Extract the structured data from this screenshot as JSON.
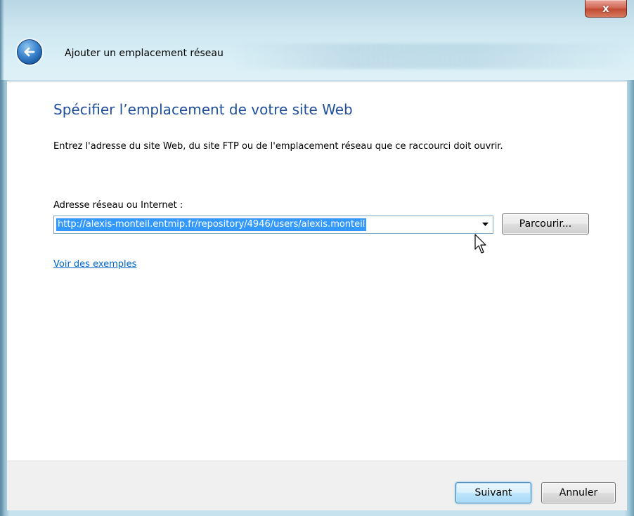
{
  "window": {
    "close_label": "x",
    "nav_title": "Ajouter un emplacement réseau"
  },
  "main": {
    "heading": "Spécifier l’emplacement de votre site Web",
    "instruction": "Entrez l'adresse du site Web, du site FTP ou de l'emplacement réseau que ce raccourci doit ouvrir.",
    "field_label": "Adresse réseau ou Internet :",
    "address_value": "http://alexis-monteil.entmip.fr/repository/4946/users/alexis.monteil",
    "browse_label": "Parcourir...",
    "examples_link": "Voir des exemples"
  },
  "footer": {
    "next_label": "Suivant",
    "cancel_label": "Annuler"
  },
  "colors": {
    "heading": "#1f4e9c",
    "link": "#0066cc",
    "selection": "#3399ff"
  },
  "icons": {
    "back": "back-arrow-icon",
    "close": "close-icon",
    "dropdown": "chevron-down-icon",
    "cursor": "mouse-cursor-icon"
  }
}
